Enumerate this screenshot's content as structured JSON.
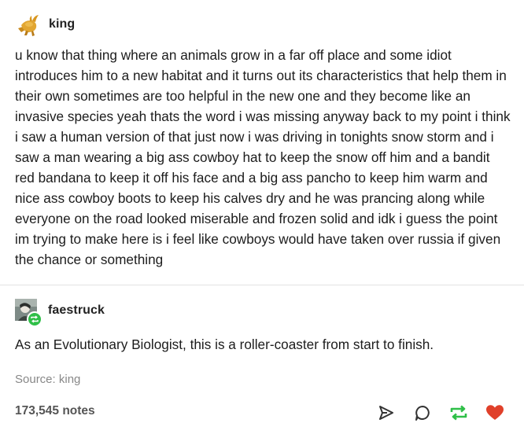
{
  "op": {
    "username": "king",
    "avatar_icon": "golden-bull-icon",
    "text": "u know that thing where an animals grow in a far off place and some idiot introduces him to a new habitat and it turns out its characteristics that help them in their own sometimes are too helpful in the new one and they become like an invasive species yeah thats the word i was missing anyway back to my point i think i saw a human version of that just now i was driving in tonights snow storm and i saw a man wearing a big ass cowboy hat to keep the snow off him and a bandit red bandana to keep it off his face and a big ass pancho to keep him warm and nice ass cowboy boots to keep his calves dry and he was prancing along while everyone on the road looked miserable and frozen solid and idk i guess the point im trying to make here is i feel like cowboys would have taken over russia if given the chance or something"
  },
  "reply": {
    "username": "faestruck",
    "avatar_icon": "user-photo-avatar",
    "reblog_badge_icon": "reblog-icon",
    "text": "As an Evolutionary Biologist, this is a roller-coaster from start to finish."
  },
  "source": {
    "text": "Source: king"
  },
  "footer": {
    "notes": "173,545 notes",
    "actions": [
      "share-icon",
      "reply-icon",
      "reblog-icon",
      "like-icon"
    ]
  },
  "colors": {
    "reblog_green": "#2fbf48",
    "like_red": "#e0402a",
    "divider": "#e2e2e2"
  }
}
